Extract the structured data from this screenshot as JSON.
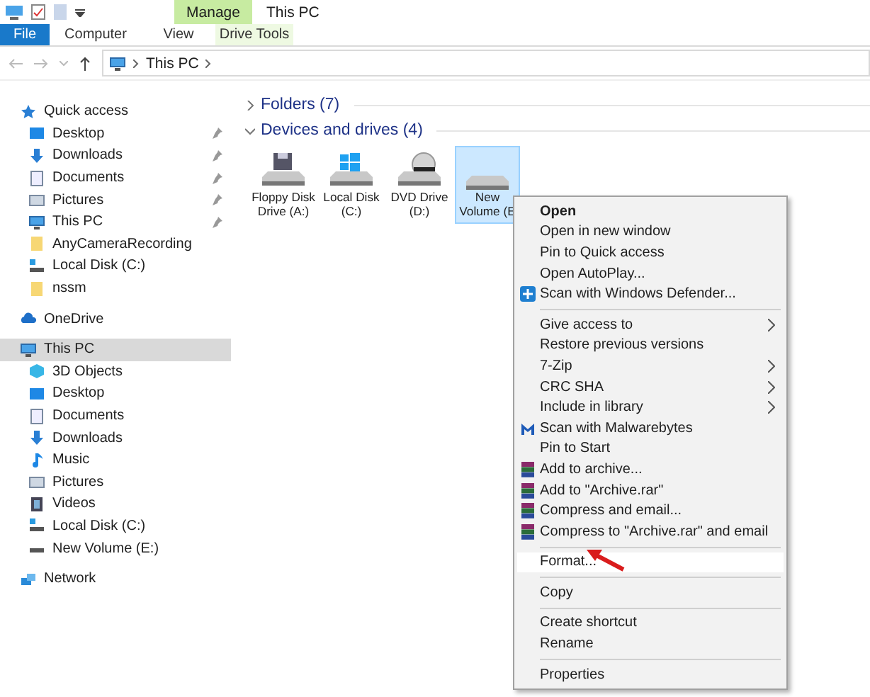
{
  "ribbon": {
    "context_tab": "Manage",
    "title": "This PC",
    "tabs": [
      {
        "label": "File",
        "kind": "file",
        "selected": false
      },
      {
        "label": "Computer",
        "kind": "tab",
        "selected": false
      },
      {
        "label": "View",
        "kind": "tab",
        "selected": false
      },
      {
        "label": "Drive Tools",
        "kind": "context",
        "selected": false
      }
    ]
  },
  "address": {
    "path": "This PC"
  },
  "sidebar": {
    "items": [
      {
        "label": "Quick access",
        "kind": "star",
        "selected": false,
        "children": [
          {
            "label": "Desktop",
            "kind": "desktop",
            "selected": false,
            "pinned": true
          },
          {
            "label": "Downloads",
            "kind": "download",
            "selected": false,
            "pinned": true
          },
          {
            "label": "Documents",
            "kind": "doc",
            "selected": false,
            "pinned": true
          },
          {
            "label": "Pictures",
            "kind": "pictures",
            "selected": false,
            "pinned": true
          },
          {
            "label": "This PC",
            "kind": "pc",
            "selected": false,
            "pinned": true
          },
          {
            "label": "AnyCameraRecording",
            "kind": "folder",
            "selected": false,
            "pinned": false
          },
          {
            "label": "Local Disk (C:)",
            "kind": "disk",
            "selected": false,
            "pinned": false
          },
          {
            "label": "nssm",
            "kind": "folder",
            "selected": false,
            "pinned": false
          }
        ]
      },
      {
        "label": "OneDrive",
        "kind": "cloud",
        "selected": false
      },
      {
        "label": "This PC",
        "kind": "pc",
        "selected": true,
        "children": [
          {
            "label": "3D Objects",
            "kind": "cube",
            "selected": false
          },
          {
            "label": "Desktop",
            "kind": "desktop",
            "selected": false
          },
          {
            "label": "Documents",
            "kind": "doc",
            "selected": false
          },
          {
            "label": "Downloads",
            "kind": "download",
            "selected": false
          },
          {
            "label": "Music",
            "kind": "music",
            "selected": false
          },
          {
            "label": "Pictures",
            "kind": "pictures",
            "selected": false
          },
          {
            "label": "Videos",
            "kind": "video",
            "selected": false
          },
          {
            "label": "Local Disk (C:)",
            "kind": "disk",
            "selected": false
          },
          {
            "label": "New Volume (E:)",
            "kind": "drive",
            "selected": false
          }
        ]
      },
      {
        "label": "Network",
        "kind": "network",
        "selected": false
      }
    ]
  },
  "groups": [
    {
      "title": "Folders (7)",
      "expanded": false
    },
    {
      "title": "Devices and drives (4)",
      "expanded": true,
      "drives": [
        {
          "lines": [
            "Floppy Disk",
            "Drive (A:)"
          ],
          "kind": "floppy",
          "selected": false
        },
        {
          "lines": [
            "Local Disk",
            "(C:)"
          ],
          "kind": "windows",
          "selected": false
        },
        {
          "lines": [
            "DVD Drive",
            "(D:)"
          ],
          "kind": "dvd",
          "selected": false
        },
        {
          "lines": [
            "New",
            "Volume (E"
          ],
          "kind": "plain",
          "selected": true
        }
      ]
    }
  ],
  "context_menu": {
    "items": [
      {
        "kind": "item",
        "label": "Open",
        "bold": true,
        "submenu": false,
        "selected": false
      },
      {
        "kind": "item",
        "label": "Open in new window",
        "bold": false,
        "submenu": false,
        "selected": false
      },
      {
        "kind": "item",
        "label": "Pin to Quick access",
        "bold": false,
        "submenu": false,
        "selected": false
      },
      {
        "kind": "item",
        "label": "Open AutoPlay...",
        "bold": false,
        "submenu": false,
        "selected": false
      },
      {
        "kind": "shield_item",
        "label": "Scan with Windows Defender...",
        "bold": false,
        "submenu": false,
        "selected": false
      },
      {
        "kind": "separator"
      },
      {
        "kind": "item",
        "label": "Give access to",
        "bold": false,
        "submenu": true,
        "selected": false
      },
      {
        "kind": "item",
        "label": "Restore previous versions",
        "bold": false,
        "submenu": false,
        "selected": false
      },
      {
        "kind": "item",
        "label": "7-Zip",
        "bold": false,
        "submenu": true,
        "selected": false
      },
      {
        "kind": "item",
        "label": "CRC SHA",
        "bold": false,
        "submenu": true,
        "selected": false
      },
      {
        "kind": "item",
        "label": "Include in library",
        "bold": false,
        "submenu": true,
        "selected": false
      },
      {
        "kind": "malware_item",
        "label": "Scan with Malwarebytes",
        "bold": false,
        "submenu": false,
        "selected": false
      },
      {
        "kind": "item",
        "label": "Pin to Start",
        "bold": false,
        "submenu": false,
        "selected": false
      },
      {
        "kind": "archive_item",
        "label": "Add to archive...",
        "bold": false,
        "submenu": false,
        "selected": false
      },
      {
        "kind": "archive_item",
        "label": "Add to \"Archive.rar\"",
        "bold": false,
        "submenu": false,
        "selected": false
      },
      {
        "kind": "archive_item",
        "label": "Compress and email...",
        "bold": false,
        "submenu": false,
        "selected": false
      },
      {
        "kind": "archive_item",
        "label": "Compress to \"Archive.rar\" and email",
        "bold": false,
        "submenu": false,
        "selected": false
      },
      {
        "kind": "separator"
      },
      {
        "kind": "item",
        "label": "Format...",
        "bold": false,
        "submenu": false,
        "selected": true
      },
      {
        "kind": "separator"
      },
      {
        "kind": "item",
        "label": "Copy",
        "bold": false,
        "submenu": false,
        "selected": false
      },
      {
        "kind": "separator"
      },
      {
        "kind": "item",
        "label": "Create shortcut",
        "bold": false,
        "submenu": false,
        "selected": false
      },
      {
        "kind": "item",
        "label": "Rename",
        "bold": false,
        "submenu": false,
        "selected": false
      },
      {
        "kind": "separator"
      },
      {
        "kind": "item",
        "label": "Properties",
        "bold": false,
        "submenu": false,
        "selected": false
      }
    ]
  }
}
